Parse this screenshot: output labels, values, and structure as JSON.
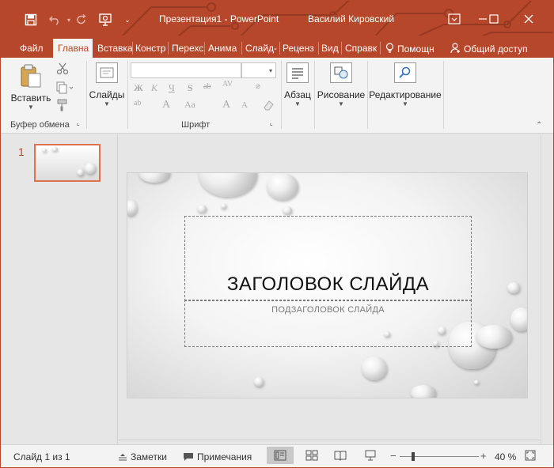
{
  "window": {
    "title": "Презентация1  -  PowerPoint",
    "user": "Василий Кировский",
    "accent": "#b7472a"
  },
  "tabs": [
    {
      "label": "Файл"
    },
    {
      "label": "Главна",
      "active": true
    },
    {
      "label": "Вставка"
    },
    {
      "label": "Констр"
    },
    {
      "label": "Перехс"
    },
    {
      "label": "Анима"
    },
    {
      "label": "Слайд-"
    },
    {
      "label": "Реценз"
    },
    {
      "label": "Вид"
    },
    {
      "label": "Справк"
    },
    {
      "label": "Помощн"
    },
    {
      "label": "Общий доступ"
    }
  ],
  "ribbon": {
    "paste": "Вставить",
    "slides": "Слайды",
    "paragraph": "Абзац",
    "drawing": "Рисование",
    "editing": "Редактирование",
    "group_clipboard": "Буфер обмена",
    "group_font": "Шрифт",
    "font_buttons": [
      "Ж",
      "К",
      "Ч",
      "S",
      "ab",
      "A",
      "Аа",
      "A",
      "A",
      "A"
    ]
  },
  "thumbnails": {
    "number": "1"
  },
  "slide": {
    "title": "ЗАГОЛОВОК СЛАЙДА",
    "subtitle": "ПОДЗАГОЛОВОК СЛАЙДА"
  },
  "status": {
    "slide_info": "Слайд 1 из 1",
    "notes": "Заметки",
    "comments": "Примечания",
    "zoom": "40 %",
    "zoom_level": 40
  }
}
